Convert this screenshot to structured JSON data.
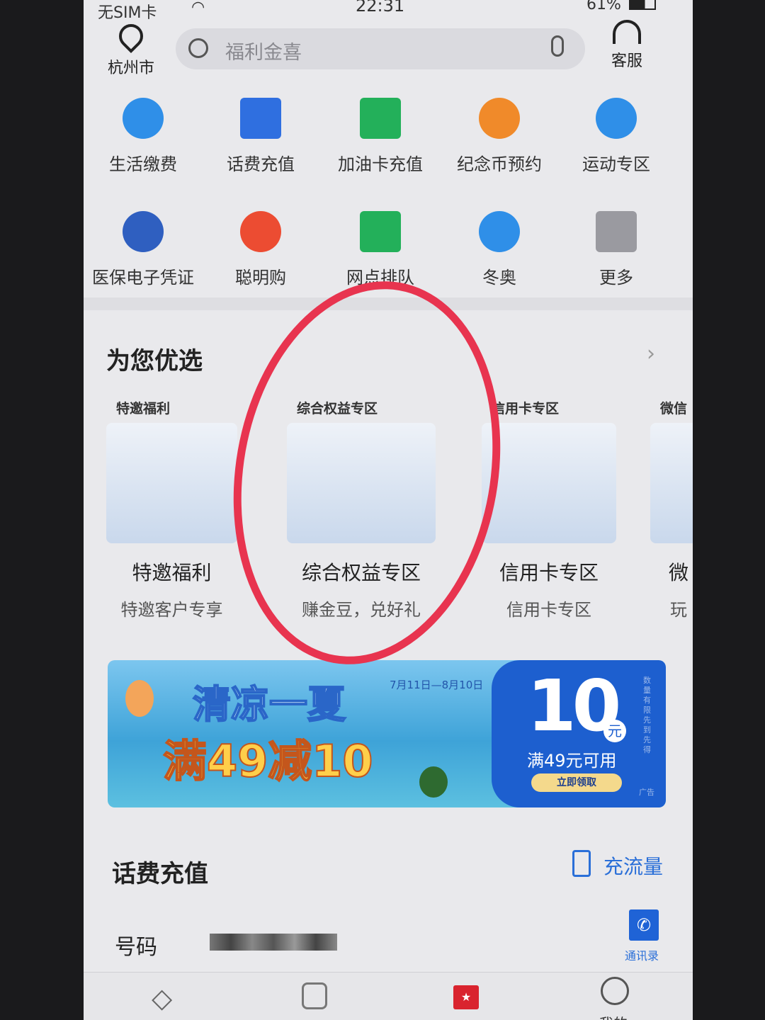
{
  "status_bar": {
    "carrier": "无SIM卡",
    "time": "22:31",
    "battery": "61%"
  },
  "header": {
    "location": "杭州市",
    "search_placeholder": "福利金喜",
    "service": "客服"
  },
  "grid": [
    {
      "label": "生活缴费",
      "icon": "lightning-icon",
      "color": "#2f8fe8"
    },
    {
      "label": "话费充值",
      "icon": "hui-icon",
      "color": "#2f6fe0"
    },
    {
      "label": "加油卡充值",
      "icon": "fuel-card-icon",
      "color": "#23b05a"
    },
    {
      "label": "纪念币预约",
      "icon": "coin-star-icon",
      "color": "#f08a2a"
    },
    {
      "label": "运动专区",
      "icon": "sport-icon",
      "color": "#2f8fe8"
    },
    {
      "label": "医保电子凭证",
      "icon": "chs-icon",
      "color": "#2f5fc0"
    },
    {
      "label": "聪明购",
      "icon": "cart-icon",
      "color": "#ec4c32"
    },
    {
      "label": "网点排队",
      "icon": "store-icon",
      "color": "#23b05a"
    },
    {
      "label": "冬奥",
      "icon": "skier-icon",
      "color": "#2f8fe8"
    },
    {
      "label": "更多",
      "icon": "more-grid-icon",
      "color": "#9a9aa0"
    }
  ],
  "recommend": {
    "title": "为您优选",
    "cards": [
      {
        "tag": "特邀福利",
        "title": "特邀福利",
        "subtitle": "特邀客户专享"
      },
      {
        "tag": "综合权益专区",
        "title": "综合权益专区",
        "subtitle": "赚金豆，兑好礼"
      },
      {
        "tag": "信用卡专区",
        "title": "信用卡专区",
        "subtitle": "信用卡专区"
      },
      {
        "tag": "微信",
        "title": "微",
        "subtitle": "玩"
      }
    ]
  },
  "banner": {
    "line1": "清凉一夏",
    "line2": "满49减10",
    "dates": "7月11日—8月10日",
    "amount": "10",
    "unit": "元",
    "condition": "满49元可用",
    "button": "立即领取",
    "side_note": "数量有限 先到先得",
    "ad": "广告"
  },
  "topup": {
    "title": "话费充值",
    "data_link": "充流量",
    "number_label": "号码",
    "contacts": "通讯录"
  },
  "nav": {
    "items": [
      {
        "icon": "diamond-icon"
      },
      {
        "icon": "chart-icon"
      },
      {
        "icon": "shopping-bag-icon",
        "active": true
      },
      {
        "icon": "user-icon",
        "label": "我的"
      }
    ],
    "active_color": "#d9232e"
  },
  "annotation_color": "#e8344f"
}
